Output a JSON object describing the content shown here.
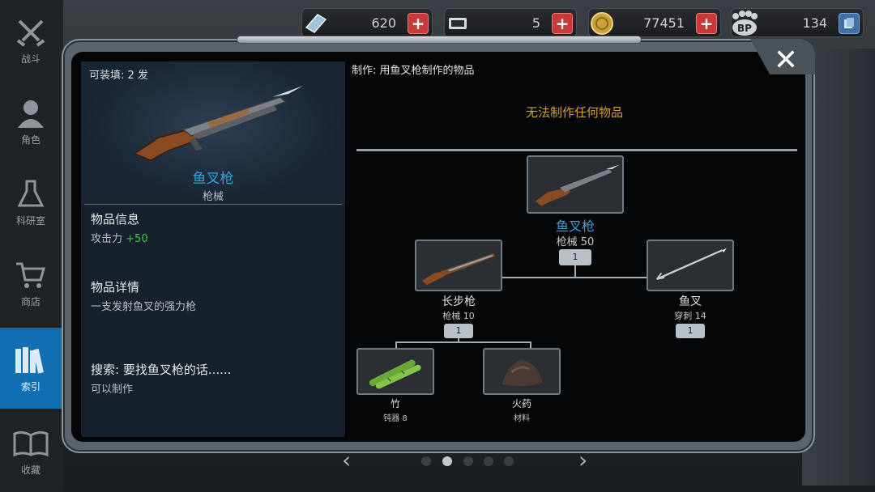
{
  "nav": {
    "items": [
      {
        "label": "战斗",
        "icon": "crossed-swords-icon"
      },
      {
        "label": "角色",
        "icon": "character-icon"
      },
      {
        "label": "科研室",
        "icon": "flask-icon"
      },
      {
        "label": "商店",
        "icon": "shopping-cart-icon"
      },
      {
        "label": "索引",
        "icon": "books-icon",
        "active": true
      },
      {
        "label": "收藏",
        "icon": "open-book-icon"
      }
    ]
  },
  "currencies": [
    {
      "name": "crystal",
      "value": "620",
      "icon": "crystal-icon"
    },
    {
      "name": "tickets",
      "value": "5",
      "icon": "ticket-icon"
    },
    {
      "name": "gold",
      "value": "77451",
      "icon": "gold-coin-icon"
    },
    {
      "name": "bp",
      "value": "134",
      "icon": "bp-paw-icon",
      "icon_text": "BP"
    }
  ],
  "item": {
    "capacity": "可装填: 2 发",
    "name": "鱼叉枪",
    "type": "枪械",
    "info_title": "物品信息",
    "stat_label": "攻击力",
    "stat_value": "+50",
    "detail_title": "物品详情",
    "detail_text": "一支发射鱼叉的强力枪",
    "search_title": "搜索: 要找鱼叉枪的话......",
    "search_text": "可以制作"
  },
  "craft": {
    "header": "制作: 用鱼叉枪制作的物品",
    "none_text": "无法制作任何物品",
    "tree": {
      "root": {
        "name": "鱼叉枪",
        "sub": "枪械 50",
        "qty": "1"
      },
      "left": {
        "name": "长步枪",
        "sub": "枪械 10",
        "qty": "1"
      },
      "right": {
        "name": "鱼叉",
        "sub": "穿刺 14",
        "qty": "1"
      },
      "left_children": [
        {
          "name": "竹",
          "sub": "钝器 8"
        },
        {
          "name": "火药",
          "sub": "材料"
        }
      ]
    }
  },
  "pager": {
    "prev": "‹",
    "next": "›",
    "count": 5,
    "active": 1
  },
  "colors": {
    "accent": "#0f6fb0",
    "item_name": "#2ea3e6",
    "warning": "#d2a03a",
    "stat_positive": "#3cc84a"
  }
}
